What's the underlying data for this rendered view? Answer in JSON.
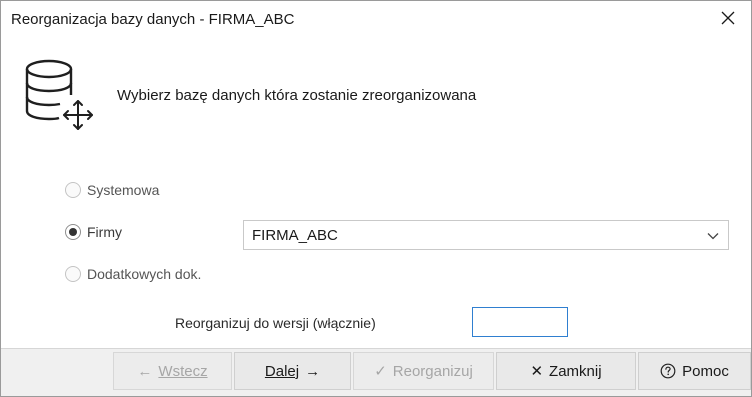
{
  "window": {
    "title": "Reorganizacja bazy danych - FIRMA_ABC"
  },
  "header": {
    "icon": "database-move-icon",
    "text": "Wybierz bazę danych która zostanie zreorganizowana"
  },
  "options": {
    "system": {
      "label": "Systemowa",
      "checked": false
    },
    "company": {
      "label": "Firmy",
      "checked": true
    },
    "additional": {
      "label": "Dodatkowych dok.",
      "checked": false
    }
  },
  "company_select": {
    "value": "FIRMA_ABC"
  },
  "version": {
    "label": "Reorganizuj do wersji (włącznie)",
    "value": ""
  },
  "buttons": {
    "back": {
      "arrow": "←",
      "label": "Wstecz",
      "enabled": false
    },
    "next": {
      "label": "Dalej",
      "arrow": "→",
      "enabled": true
    },
    "reorganize": {
      "check": "✓",
      "label": "Reorganizuj",
      "enabled": false
    },
    "close": {
      "cross": "✕",
      "label": "Zamknij",
      "enabled": true
    },
    "help": {
      "label": "Pomoc",
      "enabled": true
    }
  },
  "colors": {
    "focus_border": "#2f7fd0",
    "button_face": "#e9e9e9",
    "disabled_text": "#a6a6a6"
  }
}
